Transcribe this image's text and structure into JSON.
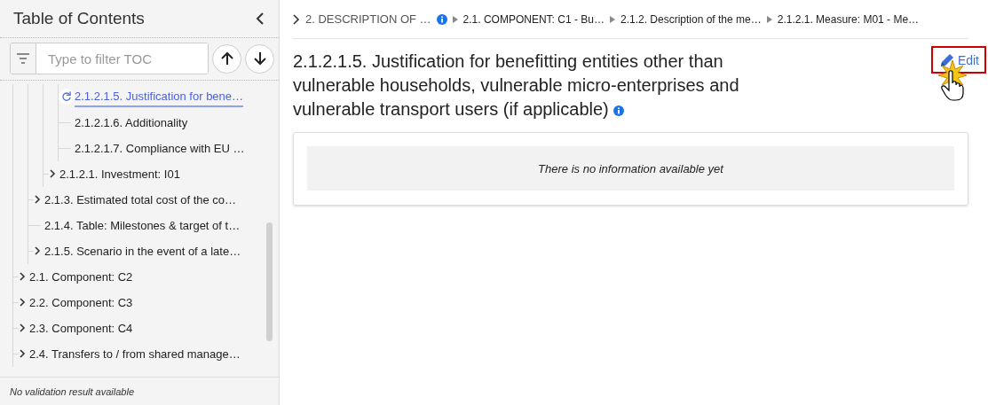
{
  "sidebar": {
    "title": "Table of Contents",
    "filter": {
      "placeholder": "Type to filter TOC"
    },
    "tree": [
      {
        "children": [
          {
            "children": [
              {
                "children": [
                  {
                    "label": "2.1.2.1.5. Justification for bene…",
                    "selected": true
                  },
                  {
                    "label": "2.1.2.1.6. Additionality",
                    "selected": false
                  },
                  {
                    "label": "2.1.2.1.7. Compliance with EU …",
                    "selected": false
                  }
                ]
              },
              {
                "label": "2.1.2.1. Investment: I01",
                "selected": false,
                "expanded": false
              }
            ]
          },
          {
            "label": "2.1.3. Estimated total cost of the co…",
            "selected": false,
            "expanded": false
          },
          {
            "label": "2.1.4. Table: Milestones & target of t…",
            "selected": false
          },
          {
            "label": "2.1.5. Scenario in the event of a late…",
            "selected": false,
            "expanded": false
          }
        ]
      },
      {
        "label": "2.1. Component: C2",
        "selected": false,
        "expanded": false
      },
      {
        "label": "2.2. Component: C3",
        "selected": false,
        "expanded": false
      },
      {
        "label": "2.3. Component: C4",
        "selected": false,
        "expanded": false
      },
      {
        "label": "2.4. Transfers to / from shared manage…",
        "selected": false,
        "expanded": false
      }
    ],
    "status": "No validation result available"
  },
  "breadcrumb": [
    {
      "label": "2. DESCRIPTION OF …",
      "info": true
    },
    {
      "label": "2.1. COMPONENT: C1 - Bu…",
      "info": false
    },
    {
      "label": "2.1.2. Description of the me…",
      "info": false
    },
    {
      "label": "2.1.2.1. Measure: M01 - Me…",
      "info": false
    }
  ],
  "section": {
    "title": "2.1.2.1.5. Justification for benefitting entities other than vulnerable households, vulnerable micro-enterprises and vulnerable transport users (if applicable)",
    "info": true,
    "edit_button": {
      "label": "Edit",
      "highlighted": true
    },
    "message": "There is no information available yet"
  }
}
